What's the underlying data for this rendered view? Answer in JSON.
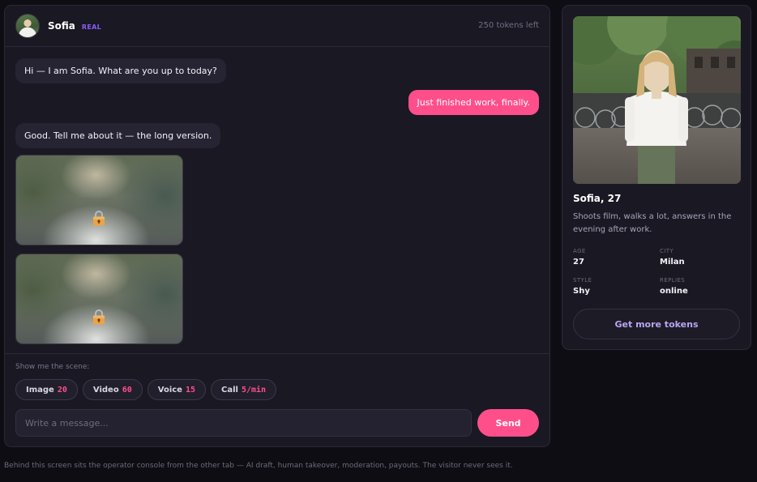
{
  "chat": {
    "header": {
      "name": "Sofia",
      "badge": "REAL",
      "tokens_left": "250 tokens left"
    },
    "messages": [
      {
        "from": "bot",
        "text": "Hi — I am Sofia. What are you up to today?"
      },
      {
        "from": "user",
        "text": "Just finished work, finally."
      },
      {
        "from": "bot",
        "text": "Good. Tell me about it — the long version."
      }
    ],
    "locked_media": [
      {
        "kind": "blurred-photo",
        "icon": "lock-icon"
      },
      {
        "kind": "blurred-photo",
        "icon": "lock-icon"
      }
    ],
    "scene_label": "Show me the scene:",
    "scene_options": [
      {
        "label": "Image",
        "price": "20"
      },
      {
        "label": "Video",
        "price": "60"
      },
      {
        "label": "Voice",
        "price": "15"
      },
      {
        "label": "Call",
        "price": "5/min"
      }
    ],
    "composer": {
      "placeholder": "Write a message...",
      "value": "",
      "send_label": "Send"
    }
  },
  "profile": {
    "name_age": "Sofia, 27",
    "bio": "Shoots film, walks a lot, answers in the evening after work.",
    "stats": {
      "age": {
        "label": "AGE",
        "value": "27"
      },
      "city": {
        "label": "CITY",
        "value": "Milan"
      },
      "style": {
        "label": "STYLE",
        "value": "Shy"
      },
      "replies": {
        "label": "REPLIES",
        "value": "online"
      }
    },
    "cta_label": "Get more tokens"
  },
  "footer_note": "Behind this screen sits the operator console from the other tab — AI draft, human takeover, moderation, payouts. The visitor never sees it.",
  "colors": {
    "background": "#0e0d13",
    "panel": "#1a1823",
    "accent_pink": "#ff4f8b",
    "badge_purple": "#8a5cf6"
  }
}
